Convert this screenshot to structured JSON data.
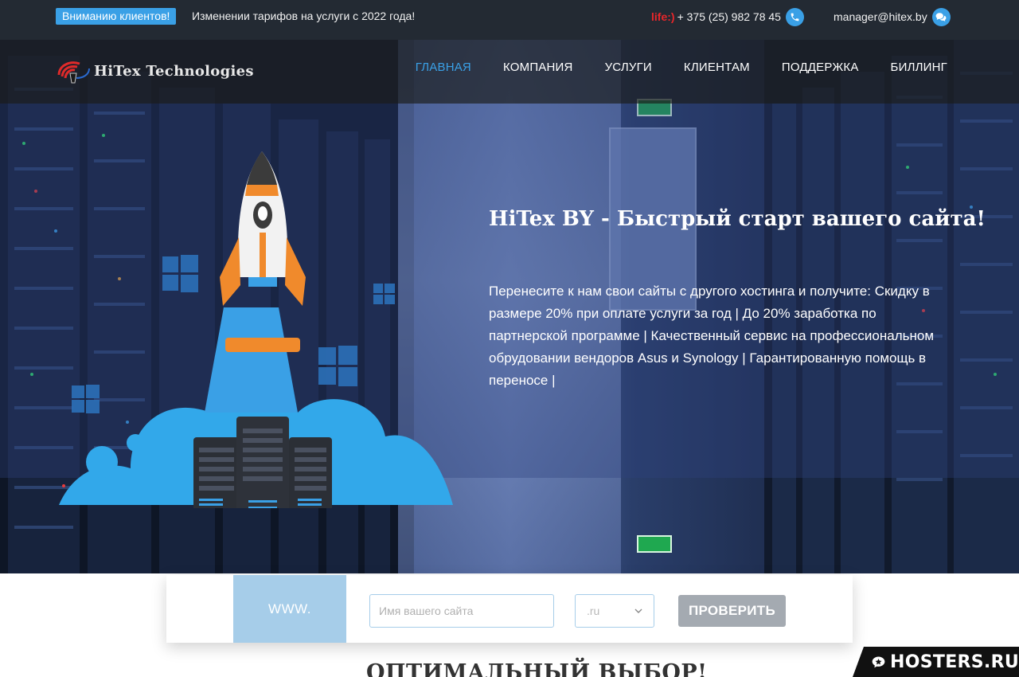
{
  "topbar": {
    "notice_badge": "Вниманию клиентов!",
    "notice_text": "Изменении тарифов на услуги с 2022 года!",
    "phone_operator": "life:)",
    "phone_number": "+ 375 (25) 982 78 45",
    "email": "manager@hitex.by"
  },
  "header": {
    "logo_text": "HiTex Technologies",
    "nav": [
      {
        "label": "ГЛАВНАЯ",
        "active": true
      },
      {
        "label": "КОМПАНИЯ"
      },
      {
        "label": "УСЛУГИ"
      },
      {
        "label": "КЛИЕНТАМ"
      },
      {
        "label": "ПОДДЕРЖКА"
      },
      {
        "label": "БИЛЛИНГ"
      }
    ]
  },
  "hero": {
    "title": "HiTex BY - Быстрый старт вашего сайта!",
    "text": "Перенесите к нам свои сайты с другого хостинга и получите: Скидку в размере 20% при оплате услуги за год | До 20% заработка по партнерской программе | Качественный сервис на профессиональном обрудовании вендоров Asus и Synology | Гарантированную помощь в переносе |"
  },
  "domain_search": {
    "prefix": "WWW.",
    "input_placeholder": "Имя вашего сайта",
    "input_value": "",
    "zone": ".ru",
    "button": "ПРОВЕРИТЬ"
  },
  "section": {
    "heading": "ОПТИМАЛЬНЫЙ ВЫБОР!"
  },
  "badge": {
    "text": "HOSTERS.RU"
  },
  "colors": {
    "accent": "#3aa0e6",
    "topbar_bg": "#232a33",
    "operator": "#e8262a",
    "button_bg": "#a4aab1",
    "www_bg": "#a6cde9"
  },
  "icons": [
    "phone-icon",
    "chat-icon",
    "chevron-down-icon",
    "hosters-logo-icon",
    "rocket-icon",
    "server-icon",
    "cloud-icon"
  ]
}
